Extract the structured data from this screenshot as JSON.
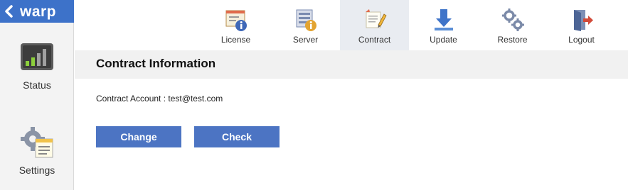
{
  "brand": {
    "name": "warp",
    "back_icon": "chevron-left-icon"
  },
  "sidebar": {
    "items": [
      {
        "label": "Status",
        "icon": "signal-bars-icon"
      },
      {
        "label": "Settings",
        "icon": "gear-code-icon"
      }
    ]
  },
  "topnav": {
    "tabs": [
      {
        "label": "License",
        "icon": "license-info-icon"
      },
      {
        "label": "Server",
        "icon": "server-info-icon"
      },
      {
        "label": "Contract",
        "icon": "contract-pencil-icon",
        "active": true
      },
      {
        "label": "Update",
        "icon": "download-arrow-icon"
      },
      {
        "label": "Restore",
        "icon": "gears-icon"
      },
      {
        "label": "Logout",
        "icon": "logout-door-icon"
      }
    ]
  },
  "main": {
    "title": "Contract Information",
    "account_text": "Contract Account : test@test.com",
    "buttons": {
      "change": "Change",
      "check": "Check"
    }
  },
  "colors": {
    "accent": "#3d72c9",
    "button": "#4c74c3",
    "active_tab": "#e9ecf1"
  }
}
